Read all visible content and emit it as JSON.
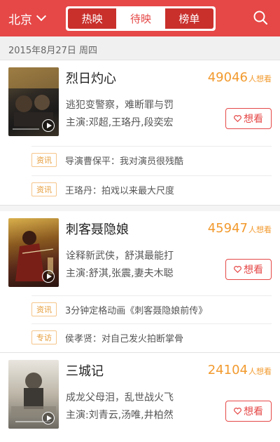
{
  "header": {
    "city": "北京",
    "tabs": [
      {
        "label": "热映",
        "active": false
      },
      {
        "label": "待映",
        "active": true
      },
      {
        "label": "榜单",
        "active": false
      }
    ],
    "accent_color": "#e54847"
  },
  "date_bar": {
    "text": "2015年8月27日 周四"
  },
  "movies": [
    {
      "title": "烈日灼心",
      "want_count": "49046",
      "want_suffix": "人想看",
      "desc": "逃犯变警察，难断罪与罚",
      "actors": "主演:邓超,王珞丹,段奕宏",
      "button": "想看",
      "news": [
        {
          "tag": "资讯",
          "text": "导演曹保平：我对演员很残酷"
        },
        {
          "tag": "资讯",
          "text": "王珞丹：拍戏以来最大尺度"
        }
      ]
    },
    {
      "title": "刺客聂隐娘",
      "want_count": "45947",
      "want_suffix": "人想看",
      "desc": "诠释新武侠，舒淇最能打",
      "actors": "主演:舒淇,张震,妻夫木聪",
      "button": "想看",
      "news": [
        {
          "tag": "资讯",
          "text": "3分钟定格动画《刺客聂隐娘前传》"
        },
        {
          "tag": "专访",
          "text": "侯孝贤：对自己发火拍断掌骨"
        }
      ]
    },
    {
      "title": "三城记",
      "want_count": "24104",
      "want_suffix": "人想看",
      "desc": "成龙父母泪，乱世战火飞",
      "actors": "主演:刘青云,汤唯,井柏然",
      "button": "想看",
      "news": []
    }
  ]
}
